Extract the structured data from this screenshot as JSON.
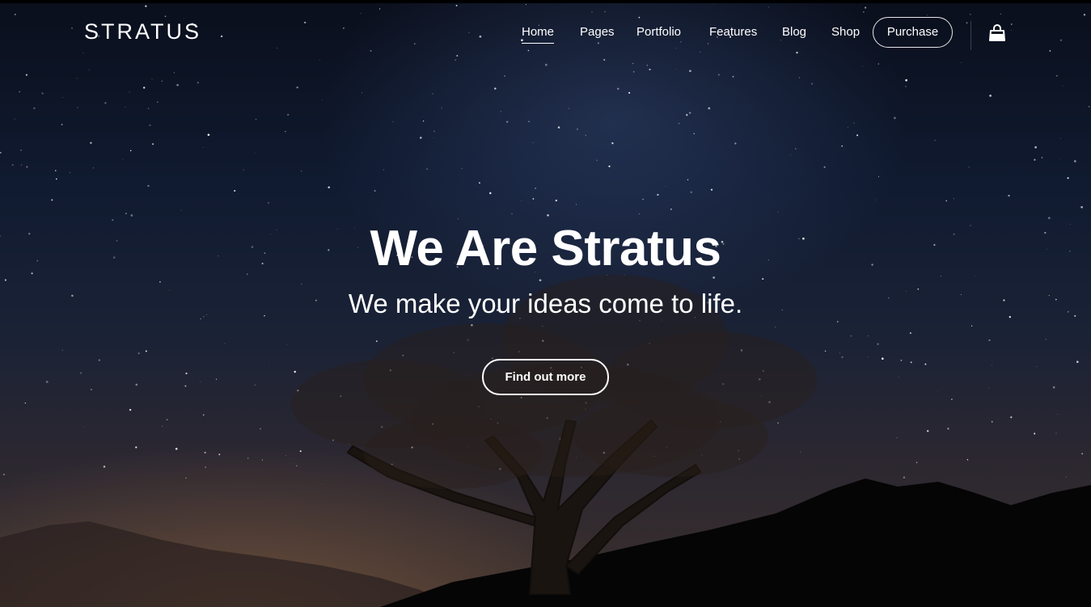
{
  "brand": {
    "logo_text": "STRATUS"
  },
  "nav": {
    "items": [
      {
        "label": "Home",
        "active": true
      },
      {
        "label": "Pages",
        "active": false
      },
      {
        "label": "Portfolio",
        "active": false
      },
      {
        "label": "Features",
        "active": false
      },
      {
        "label": "Blog",
        "active": false
      },
      {
        "label": "Shop",
        "active": false
      }
    ],
    "purchase_label": "Purchase",
    "cart_icon": "shopping-bag-icon"
  },
  "hero": {
    "title": "We Are Stratus",
    "subtitle": "We make your ideas come to life.",
    "cta_label": "Find out more",
    "background": "starry-night-sky-with-tree"
  },
  "colors": {
    "text": "#ffffff",
    "sky_top": "#0a0f1c",
    "sky_mid": "#1a2236",
    "horizon_glow": "#3a2f2c"
  }
}
